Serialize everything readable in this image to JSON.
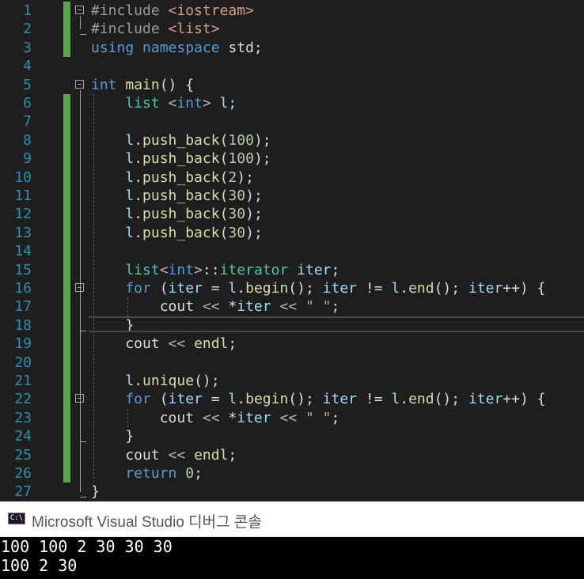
{
  "editor": {
    "lines": [
      {
        "n": "1",
        "tokens": [
          {
            "t": "#include ",
            "c": "inc"
          },
          {
            "t": "<iostream>",
            "c": "str"
          }
        ]
      },
      {
        "n": "2",
        "tokens": [
          {
            "t": "#include ",
            "c": "inc"
          },
          {
            "t": "<list>",
            "c": "str"
          }
        ]
      },
      {
        "n": "3",
        "tokens": [
          {
            "t": "using ",
            "c": "kw"
          },
          {
            "t": "namespace ",
            "c": "kw"
          },
          {
            "t": "std;",
            "c": "plain"
          }
        ]
      },
      {
        "n": "4",
        "tokens": []
      },
      {
        "n": "5",
        "tokens": [
          {
            "t": "int ",
            "c": "kw"
          },
          {
            "t": "main",
            "c": "fn"
          },
          {
            "t": "() {",
            "c": "plain"
          }
        ]
      },
      {
        "n": "6",
        "tokens": [
          {
            "t": "    list ",
            "c": "ty"
          },
          {
            "t": "<",
            "c": "op"
          },
          {
            "t": "int",
            "c": "kw"
          },
          {
            "t": "> ",
            "c": "op"
          },
          {
            "t": "l;",
            "c": "var"
          }
        ]
      },
      {
        "n": "7",
        "tokens": []
      },
      {
        "n": "8",
        "tokens": [
          {
            "t": "    l",
            "c": "var"
          },
          {
            "t": ".",
            "c": "plain"
          },
          {
            "t": "push_back",
            "c": "fn"
          },
          {
            "t": "(",
            "c": "plain"
          },
          {
            "t": "100",
            "c": "num"
          },
          {
            "t": ");",
            "c": "plain"
          }
        ]
      },
      {
        "n": "9",
        "tokens": [
          {
            "t": "    l",
            "c": "var"
          },
          {
            "t": ".",
            "c": "plain"
          },
          {
            "t": "push_back",
            "c": "fn"
          },
          {
            "t": "(",
            "c": "plain"
          },
          {
            "t": "100",
            "c": "num"
          },
          {
            "t": ");",
            "c": "plain"
          }
        ]
      },
      {
        "n": "10",
        "tokens": [
          {
            "t": "    l",
            "c": "var"
          },
          {
            "t": ".",
            "c": "plain"
          },
          {
            "t": "push_back",
            "c": "fn"
          },
          {
            "t": "(",
            "c": "plain"
          },
          {
            "t": "2",
            "c": "num"
          },
          {
            "t": ");",
            "c": "plain"
          }
        ]
      },
      {
        "n": "11",
        "tokens": [
          {
            "t": "    l",
            "c": "var"
          },
          {
            "t": ".",
            "c": "plain"
          },
          {
            "t": "push_back",
            "c": "fn"
          },
          {
            "t": "(",
            "c": "plain"
          },
          {
            "t": "30",
            "c": "num"
          },
          {
            "t": ");",
            "c": "plain"
          }
        ]
      },
      {
        "n": "12",
        "tokens": [
          {
            "t": "    l",
            "c": "var"
          },
          {
            "t": ".",
            "c": "plain"
          },
          {
            "t": "push_back",
            "c": "fn"
          },
          {
            "t": "(",
            "c": "plain"
          },
          {
            "t": "30",
            "c": "num"
          },
          {
            "t": ");",
            "c": "plain"
          }
        ]
      },
      {
        "n": "13",
        "tokens": [
          {
            "t": "    l",
            "c": "var"
          },
          {
            "t": ".",
            "c": "plain"
          },
          {
            "t": "push_back",
            "c": "fn"
          },
          {
            "t": "(",
            "c": "plain"
          },
          {
            "t": "30",
            "c": "num"
          },
          {
            "t": ");",
            "c": "plain"
          }
        ]
      },
      {
        "n": "14",
        "tokens": []
      },
      {
        "n": "15",
        "tokens": [
          {
            "t": "    list",
            "c": "ty"
          },
          {
            "t": "<",
            "c": "op"
          },
          {
            "t": "int",
            "c": "kw"
          },
          {
            "t": ">",
            "c": "op"
          },
          {
            "t": "::",
            "c": "plain"
          },
          {
            "t": "iterator ",
            "c": "ty"
          },
          {
            "t": "iter",
            "c": "var"
          },
          {
            "t": ";",
            "c": "plain"
          }
        ]
      },
      {
        "n": "16",
        "tokens": [
          {
            "t": "    for ",
            "c": "kw"
          },
          {
            "t": "(",
            "c": "plain"
          },
          {
            "t": "iter",
            "c": "var"
          },
          {
            "t": " = ",
            "c": "plain"
          },
          {
            "t": "l",
            "c": "var"
          },
          {
            "t": ".",
            "c": "plain"
          },
          {
            "t": "begin",
            "c": "fn"
          },
          {
            "t": "(); ",
            "c": "plain"
          },
          {
            "t": "iter",
            "c": "var"
          },
          {
            "t": " != ",
            "c": "plain"
          },
          {
            "t": "l",
            "c": "var"
          },
          {
            "t": ".",
            "c": "plain"
          },
          {
            "t": "end",
            "c": "fn"
          },
          {
            "t": "(); ",
            "c": "plain"
          },
          {
            "t": "iter",
            "c": "var"
          },
          {
            "t": "++) {",
            "c": "plain"
          }
        ]
      },
      {
        "n": "17",
        "tokens": [
          {
            "t": "        cout ",
            "c": "plain"
          },
          {
            "t": "<< ",
            "c": "op"
          },
          {
            "t": "*",
            "c": "plain"
          },
          {
            "t": "iter ",
            "c": "var"
          },
          {
            "t": "<< ",
            "c": "op"
          },
          {
            "t": "\" \"",
            "c": "str"
          },
          {
            "t": ";",
            "c": "plain"
          }
        ]
      },
      {
        "n": "18",
        "tokens": [
          {
            "t": "    }",
            "c": "plain"
          }
        ]
      },
      {
        "n": "19",
        "tokens": [
          {
            "t": "    cout ",
            "c": "plain"
          },
          {
            "t": "<< ",
            "c": "op"
          },
          {
            "t": "endl",
            "c": "fn"
          },
          {
            "t": ";",
            "c": "plain"
          }
        ]
      },
      {
        "n": "20",
        "tokens": []
      },
      {
        "n": "21",
        "tokens": [
          {
            "t": "    l",
            "c": "var"
          },
          {
            "t": ".",
            "c": "plain"
          },
          {
            "t": "unique",
            "c": "fn"
          },
          {
            "t": "();",
            "c": "plain"
          }
        ]
      },
      {
        "n": "22",
        "tokens": [
          {
            "t": "    for ",
            "c": "kw"
          },
          {
            "t": "(",
            "c": "plain"
          },
          {
            "t": "iter",
            "c": "var"
          },
          {
            "t": " = ",
            "c": "plain"
          },
          {
            "t": "l",
            "c": "var"
          },
          {
            "t": ".",
            "c": "plain"
          },
          {
            "t": "begin",
            "c": "fn"
          },
          {
            "t": "(); ",
            "c": "plain"
          },
          {
            "t": "iter",
            "c": "var"
          },
          {
            "t": " != ",
            "c": "plain"
          },
          {
            "t": "l",
            "c": "var"
          },
          {
            "t": ".",
            "c": "plain"
          },
          {
            "t": "end",
            "c": "fn"
          },
          {
            "t": "(); ",
            "c": "plain"
          },
          {
            "t": "iter",
            "c": "var"
          },
          {
            "t": "++) {",
            "c": "plain"
          }
        ]
      },
      {
        "n": "23",
        "tokens": [
          {
            "t": "        cout ",
            "c": "plain"
          },
          {
            "t": "<< ",
            "c": "op"
          },
          {
            "t": "*",
            "c": "plain"
          },
          {
            "t": "iter ",
            "c": "var"
          },
          {
            "t": "<< ",
            "c": "op"
          },
          {
            "t": "\" \"",
            "c": "str"
          },
          {
            "t": ";",
            "c": "plain"
          }
        ]
      },
      {
        "n": "24",
        "tokens": [
          {
            "t": "    }",
            "c": "plain"
          }
        ]
      },
      {
        "n": "25",
        "tokens": [
          {
            "t": "    cout ",
            "c": "plain"
          },
          {
            "t": "<< ",
            "c": "op"
          },
          {
            "t": "endl",
            "c": "fn"
          },
          {
            "t": ";",
            "c": "plain"
          }
        ]
      },
      {
        "n": "26",
        "tokens": [
          {
            "t": "    return ",
            "c": "kw"
          },
          {
            "t": "0",
            "c": "num"
          },
          {
            "t": ";",
            "c": "plain"
          }
        ]
      },
      {
        "n": "27",
        "tokens": [
          {
            "t": "}",
            "c": "plain"
          }
        ]
      }
    ]
  },
  "console": {
    "icon_text": "C:\\",
    "title": "Microsoft Visual Studio 디버그 콘솔",
    "output": [
      "100 100 2 30 30 30",
      "100 2 30"
    ]
  },
  "colors": {
    "background": "#1e1e1e",
    "line_number": "#2b91af",
    "change_bar": "#57a64a",
    "keyword": "#569cd6",
    "string": "#d69d85",
    "number": "#b5cea8",
    "function": "#dcdcaa",
    "type": "#4ec9b0",
    "variable": "#9cdcfe"
  }
}
